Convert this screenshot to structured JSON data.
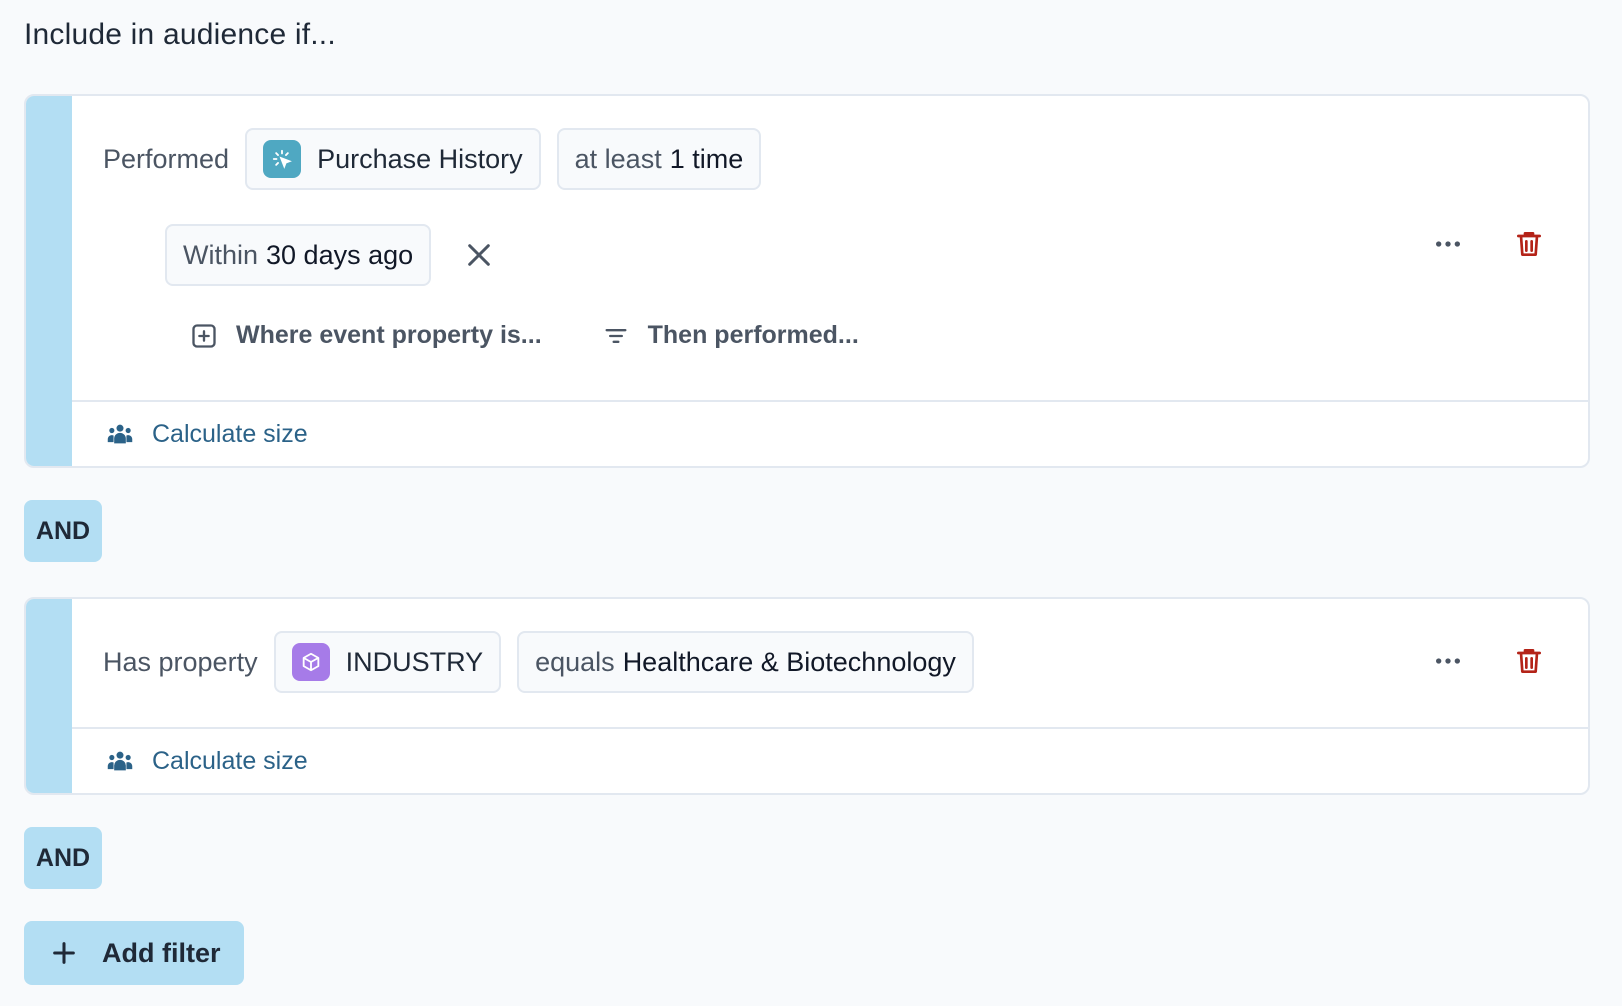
{
  "heading": "Include in audience if...",
  "filters": [
    {
      "label": "Performed",
      "event_name": "Purchase History",
      "event_icon": "cursor-click-icon",
      "event_icon_color": "#4fa8c2",
      "frequency_prefix": "at least",
      "frequency_value": "1 time",
      "time_prefix": "Within",
      "time_value": "30 days ago",
      "where_action": "Where event property is...",
      "then_action": "Then performed...",
      "calculate_label": "Calculate size"
    },
    {
      "label": "Has property",
      "property_name": "INDUSTRY",
      "property_icon": "cube-icon",
      "property_icon_color": "#a67be8",
      "operator": "equals",
      "value": "Healthcare & Biotechnology",
      "calculate_label": "Calculate size"
    }
  ],
  "and_labels": [
    "AND",
    "AND"
  ],
  "add_filter_label": "Add filter",
  "colors": {
    "stripe": "#b3def3",
    "link": "#2b6288",
    "delete": "#b42318"
  }
}
